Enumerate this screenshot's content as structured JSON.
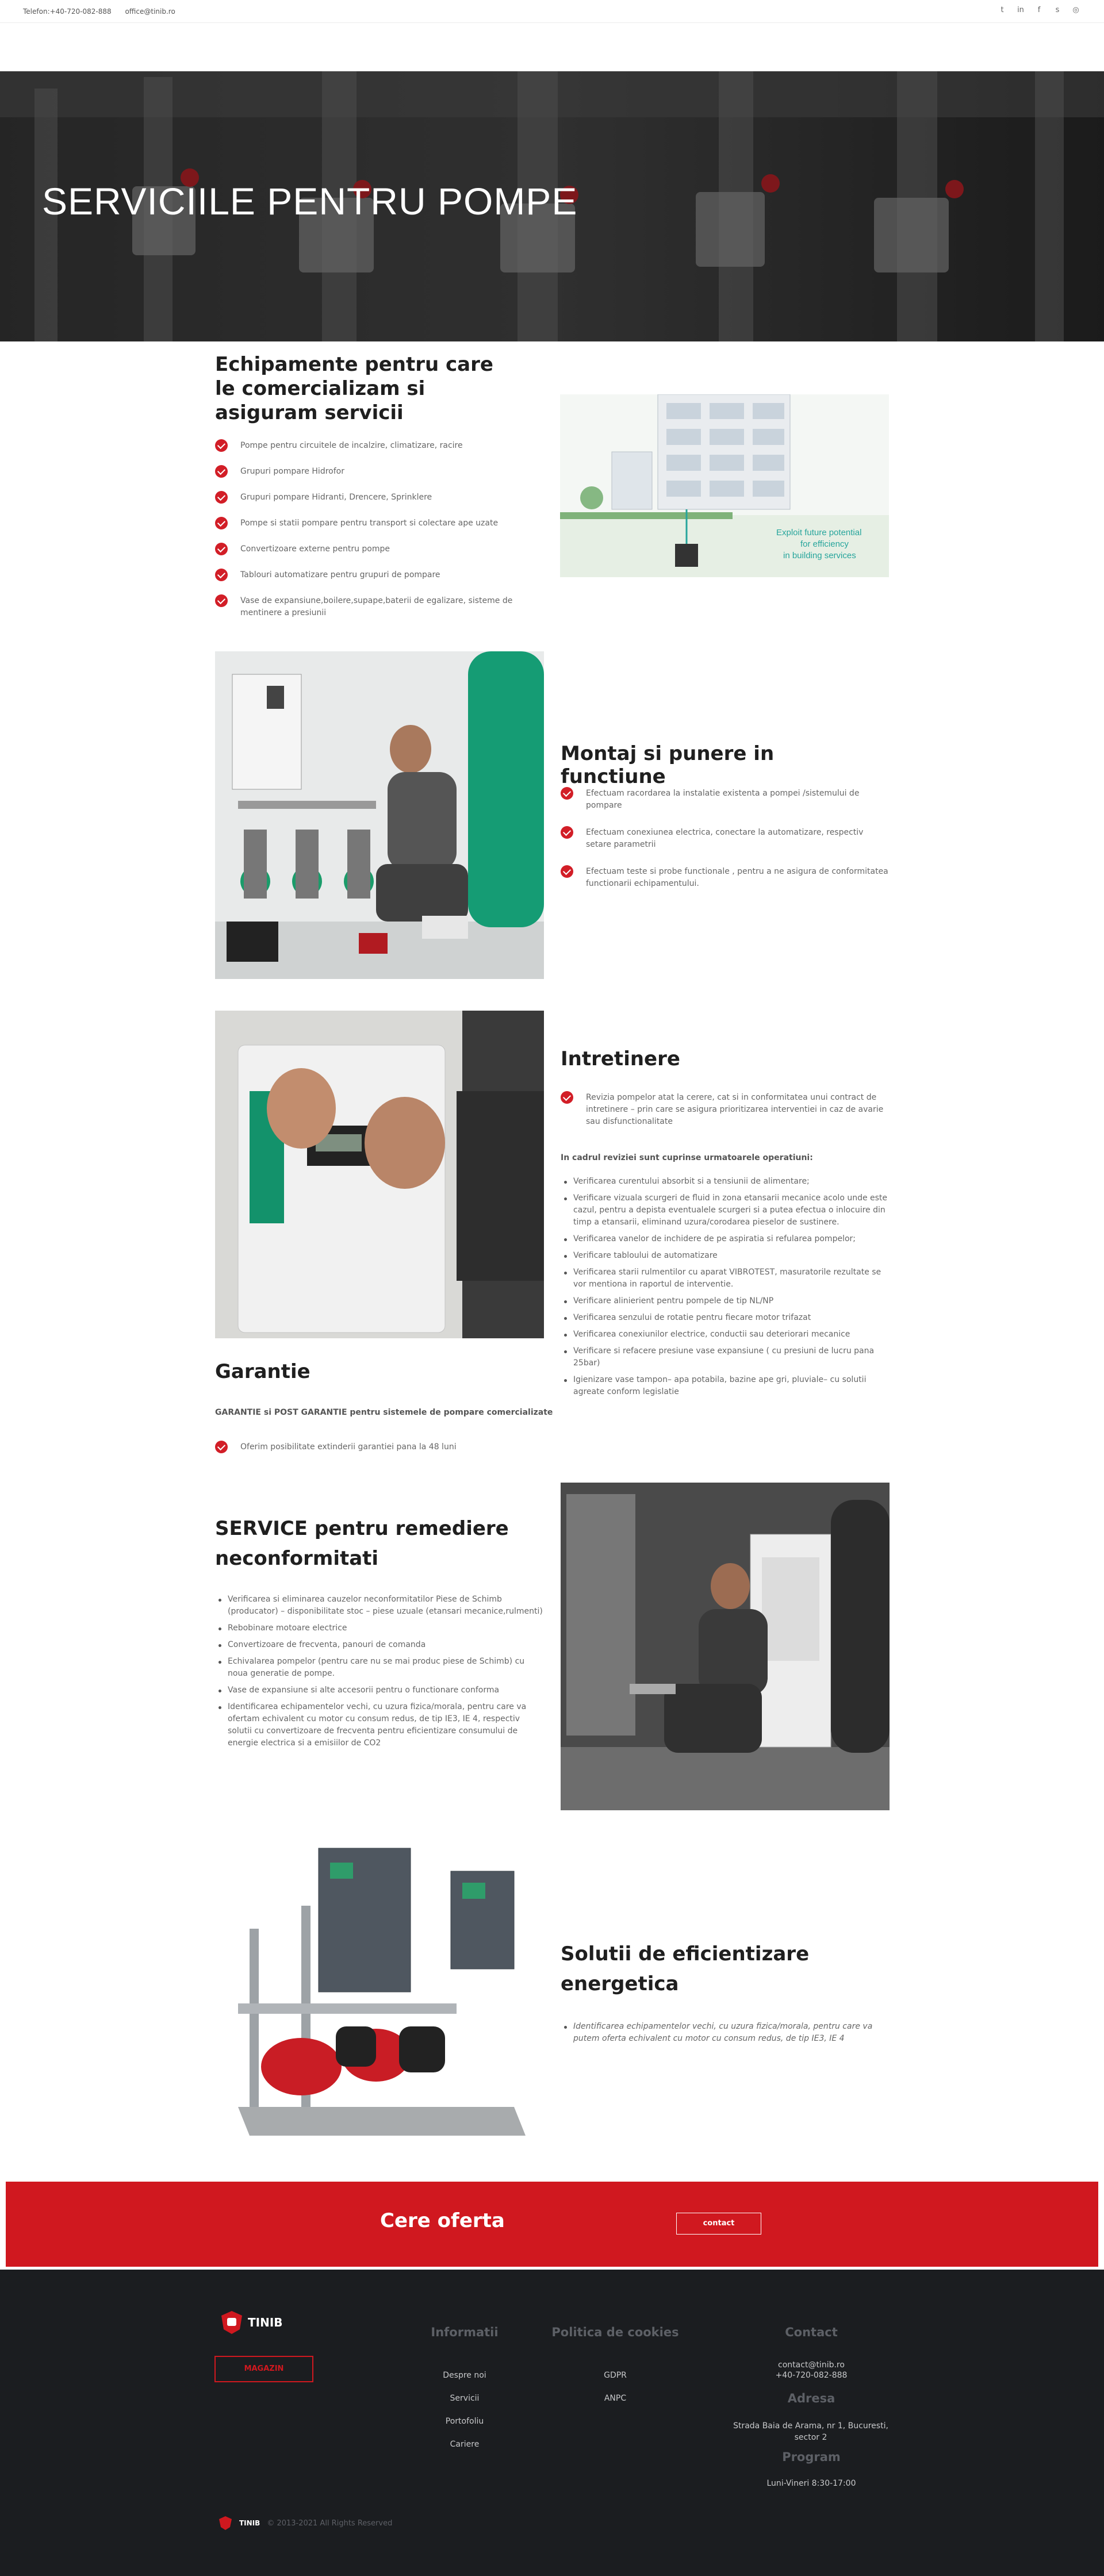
{
  "topbar": {
    "phone": "Telefon:+40-720-082-888",
    "email": "office@tinib.ro",
    "social_icons": [
      "twitter-icon",
      "linkedin-icon",
      "facebook-icon",
      "skype-icon",
      "instagram-icon"
    ]
  },
  "hero": {
    "title": "SERVICIILE PENTRU POMPE"
  },
  "section1": {
    "title": "Echipamente pentru care le comercializam si asiguram servicii",
    "items": [
      "Pompe pentru circuitele de incalzire, climatizare, racire",
      "Grupuri pompare Hidrofor",
      "Grupuri pompare Hidranti, Drencere, Sprinklere",
      "Pompe si statii pompare pentru transport si colectare ape uzate",
      "Convertizoare externe pentru pompe",
      "Tablouri automatizare pentru grupuri de pompare",
      "Vase de expansiune,boilere,supape,baterii de egalizare, sisteme de mentinere a presiunii"
    ],
    "image_text": "Exploit future potential for efficiency in building services"
  },
  "section2": {
    "title": "Montaj si punere in functiune",
    "items": [
      "Efectuam racordarea la instalatie existenta a pompei /sistemului de pompare",
      "Efectuam conexiunea electrica, conectare la automatizare, respectiv setare parametrii",
      "Efectuam teste si probe functionale , pentru a ne asigura de conformitatea functionarii echipamentului."
    ]
  },
  "section3": {
    "title": "Intretinere",
    "intro_item": "Revizia pompelor atat la cerere, cat si in conformitatea unui contract de intretinere – prin care se asigura prioritizarea interventiei in caz de avarie sau disfunctionalitate",
    "subtitle": "In cadrul reviziei sunt cuprinse urmatoarele operatiuni:",
    "bullets": [
      "Verificarea curentului absorbit si a tensiunii de alimentare;",
      "Verificare vizuala scurgeri de fluid in zona etansarii mecanice acolo unde este cazul, pentru a depista eventualele scurgeri si a putea efectua o inlocuire din timp a etansarii, eliminand uzura/corodarea pieselor de sustinere.",
      "Verificarea vanelor de inchidere de pe aspiratia si refularea pompelor;",
      "Verificare tabloului de automatizare",
      "Verificarea starii rulmentilor cu aparat VIBROTEST, masuratorile rezultate se vor mentiona in raportul de interventie.",
      "Verificare alinierient pentru pompele de tip NL/NP",
      "Verificarea senzului de rotatie pentru fiecare motor trifazat",
      "Verificarea conexiunilor electrice, conductii sau deteriorari mecanice",
      "Verificare si refacere presiune vase expansiune ( cu presiuni de lucru pana 25bar)",
      "Igienizare vase tampon– apa potabila, bazine ape gri, pluviale– cu solutii agreate conform legislatie"
    ]
  },
  "guarantee": {
    "title": "Garantie",
    "subtitle": "GARANTIE si POST GARANTIE pentru sistemele de pompare comercializate",
    "item": "Oferim posibilitate extinderii garantiei pana la 48 luni"
  },
  "section4": {
    "title": "SERVICE pentru remediere neconformitati",
    "bullets": [
      "Verificarea si eliminarea cauzelor neconformitatilor Piese de Schimb (producator) – disponibilitate stoc – piese uzuale (etansari mecanice,rulmenti)",
      "Rebobinare motoare electrice",
      "Convertizoare de frecventa, panouri de comanda",
      "Echivalarea pompelor (pentru care nu se mai produc piese de Schimb) cu noua generatie de pompe.",
      "Vase de expansiune si alte accesorii pentru o functionare conforma",
      "Identificarea echipamentelor vechi, cu uzura fizica/morala, pentru care va ofertam echivalent cu motor cu consum redus, de tip IE3, IE 4, respectiv solutii cu convertizoare de frecventa pentru eficientizare consumului de energie electrica si a emisiilor de CO2"
    ]
  },
  "section5": {
    "title": "Solutii de eficientizare energetica",
    "bullet": "Identificarea echipamentelor vechi, cu uzura fizica/morala, pentru care va putem oferta echivalent cu motor cu consum redus, de tip IE3, IE 4"
  },
  "cta": {
    "label": "Cere oferta",
    "button": "contact"
  },
  "footer": {
    "logo": "TINIB",
    "shop_button": "MAGAZIN",
    "col1": {
      "title": "Informatii",
      "items": [
        "Despre noi",
        "Servicii",
        "Portofoliu",
        "Cariere"
      ]
    },
    "col2": {
      "title": "Politica de cookies",
      "items": [
        "GDPR",
        "ANPC"
      ]
    },
    "col3": {
      "title": "Contact",
      "email": "contact@tinib.ro",
      "phone": "+40-720-082-888",
      "address_title": "Adresa",
      "address": "Strada Baia de Arama, nr 1, Bucuresti, sector 2",
      "program_title": "Program",
      "program": "Luni-Vineri 8:30-17:00"
    },
    "copyright": "© 2013-2021 All Rights Reserved"
  },
  "colors": {
    "accent": "#d0181f",
    "footer_bg": "#1b1d20"
  }
}
